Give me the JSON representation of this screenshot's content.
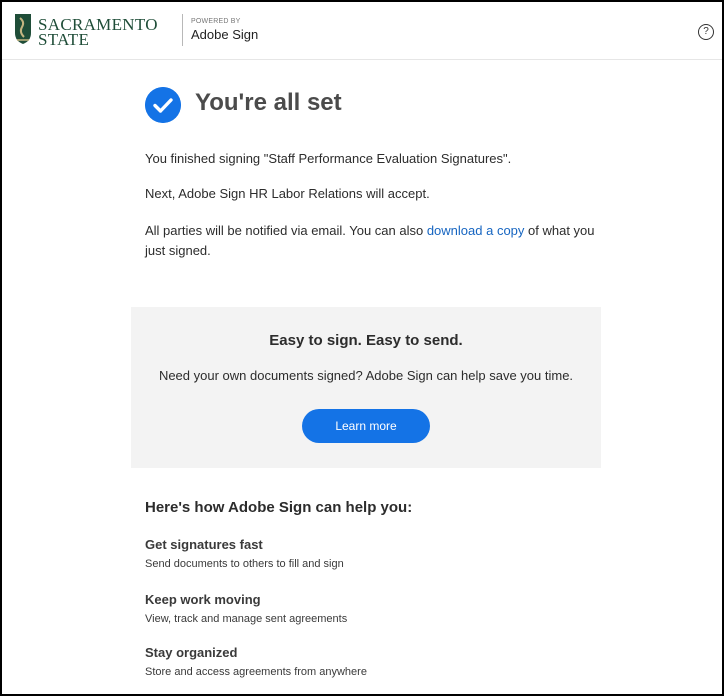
{
  "header": {
    "logo_line1": "SACRAMENTO",
    "logo_line2": "STATE",
    "powered_by": "POWERED BY",
    "product": "Adobe Sign",
    "help_icon": "question-circle-icon",
    "help_symbol": "?"
  },
  "status": {
    "icon": "checkmark-circle-icon",
    "title": "You're all set",
    "line1": "You finished signing \"Staff Performance Evaluation Signatures\".",
    "line2": "Next, Adobe Sign HR Labor Relations will accept.",
    "line3_before": "All parties will be notified via email. You can also ",
    "line3_link": "download a copy",
    "line3_after": " of what you just signed."
  },
  "promo": {
    "title": "Easy to sign. Easy to send.",
    "subtitle": "Need your own documents signed? Adobe Sign can help save you time.",
    "button_label": "Learn more"
  },
  "features": {
    "heading": "Here's how Adobe Sign can help you:",
    "items": [
      {
        "title": "Get signatures fast",
        "desc": "Send documents to others to fill and sign"
      },
      {
        "title": "Keep work moving",
        "desc": "View, track and manage sent agreements"
      },
      {
        "title": "Stay organized",
        "desc": "Store and access agreements from anywhere"
      }
    ]
  },
  "colors": {
    "accent": "#1473e6",
    "link": "#1665c1",
    "brand_green": "#1f4d38",
    "promo_bg": "#f3f3f3"
  }
}
